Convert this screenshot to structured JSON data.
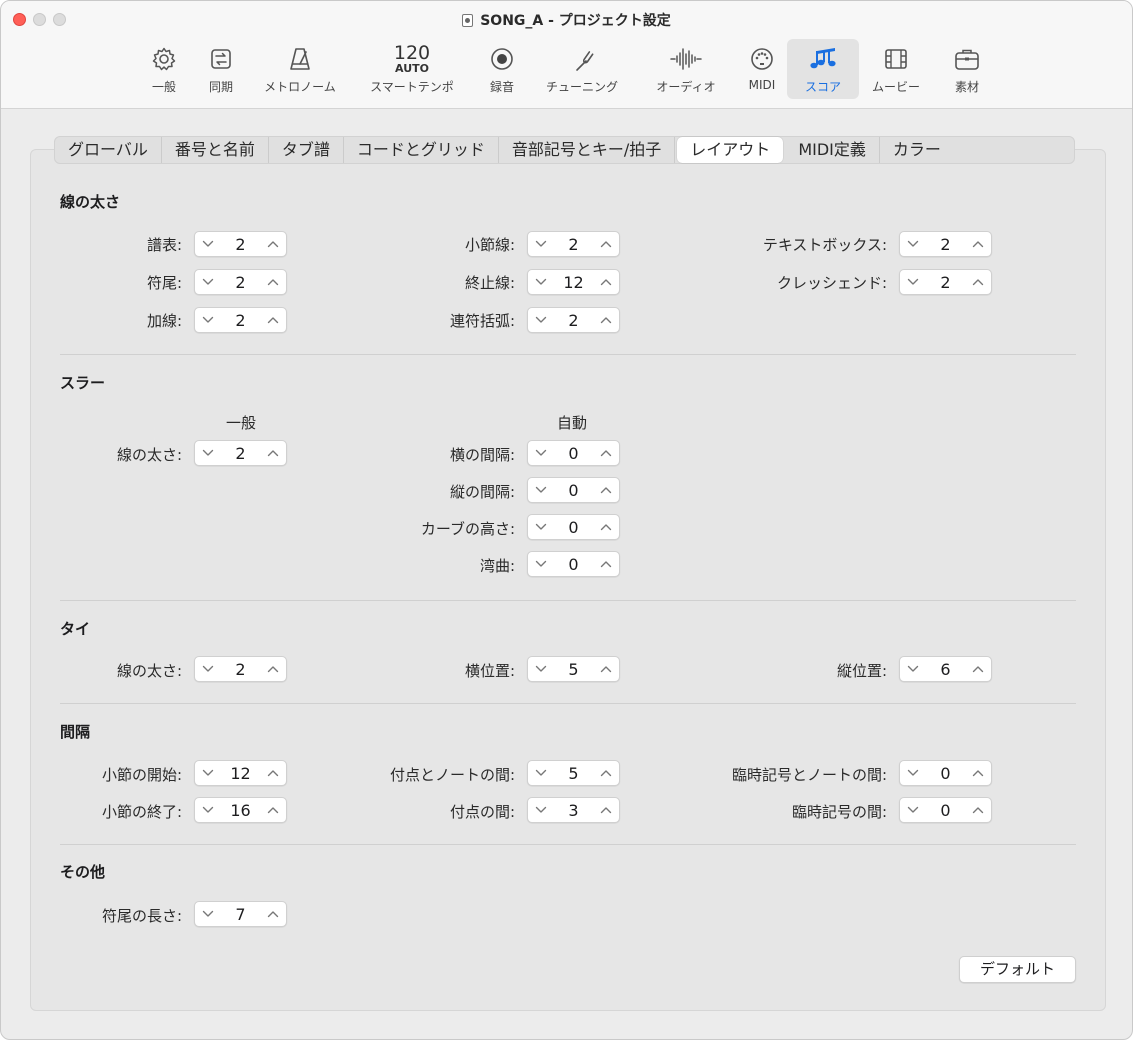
{
  "window": {
    "title": "SONG_A - プロジェクト設定"
  },
  "toolbar": {
    "general": "一般",
    "sync": "同期",
    "metronome": "メトロノーム",
    "tempo_value": "120",
    "tempo_auto": "AUTO",
    "smart_tempo": "スマートテンポ",
    "recording": "録音",
    "tuning": "チューニング",
    "audio": "オーディオ",
    "midi": "MIDI",
    "score": "スコア",
    "movie": "ムービー",
    "assets": "素材"
  },
  "tabs": [
    "グローバル",
    "番号と名前",
    "タブ譜",
    "コードとグリッド",
    "音部記号とキー/拍子",
    "レイアウト",
    "MIDI定義",
    "カラー"
  ],
  "active_tab": "レイアウト",
  "sections": {
    "line_width": {
      "title": "線の太さ",
      "staff": {
        "label": "譜表:",
        "value": "2"
      },
      "stem": {
        "label": "符尾:",
        "value": "2"
      },
      "ledger": {
        "label": "加線:",
        "value": "2"
      },
      "barline": {
        "label": "小節線:",
        "value": "2"
      },
      "ending": {
        "label": "終止線:",
        "value": "12"
      },
      "tuplet": {
        "label": "連符括弧:",
        "value": "2"
      },
      "textbox": {
        "label": "テキストボックス:",
        "value": "2"
      },
      "crescendo": {
        "label": "クレッシェンド:",
        "value": "2"
      }
    },
    "slur": {
      "title": "スラー",
      "general_head": "一般",
      "auto_head": "自動",
      "width": {
        "label": "線の太さ:",
        "value": "2"
      },
      "h_spacing": {
        "label": "横の間隔:",
        "value": "0"
      },
      "v_spacing": {
        "label": "縦の間隔:",
        "value": "0"
      },
      "curve_height": {
        "label": "カーブの高さ:",
        "value": "0"
      },
      "bend": {
        "label": "湾曲:",
        "value": "0"
      }
    },
    "tie": {
      "title": "タイ",
      "width": {
        "label": "線の太さ:",
        "value": "2"
      },
      "h_pos": {
        "label": "横位置:",
        "value": "5"
      },
      "v_pos": {
        "label": "縦位置:",
        "value": "6"
      }
    },
    "spacing": {
      "title": "間隔",
      "bar_start": {
        "label": "小節の開始:",
        "value": "12"
      },
      "bar_end": {
        "label": "小節の終了:",
        "value": "16"
      },
      "dot_note": {
        "label": "付点とノートの間:",
        "value": "5"
      },
      "dot_dot": {
        "label": "付点の間:",
        "value": "3"
      },
      "acc_note": {
        "label": "臨時記号とノートの間:",
        "value": "0"
      },
      "acc_acc": {
        "label": "臨時記号の間:",
        "value": "0"
      }
    },
    "other": {
      "title": "その他",
      "stem_length": {
        "label": "符尾の長さ:",
        "value": "7"
      }
    }
  },
  "default_button": "デフォルト",
  "colors": {
    "accent": "#1a6fe0",
    "close": "#ff5f57"
  }
}
